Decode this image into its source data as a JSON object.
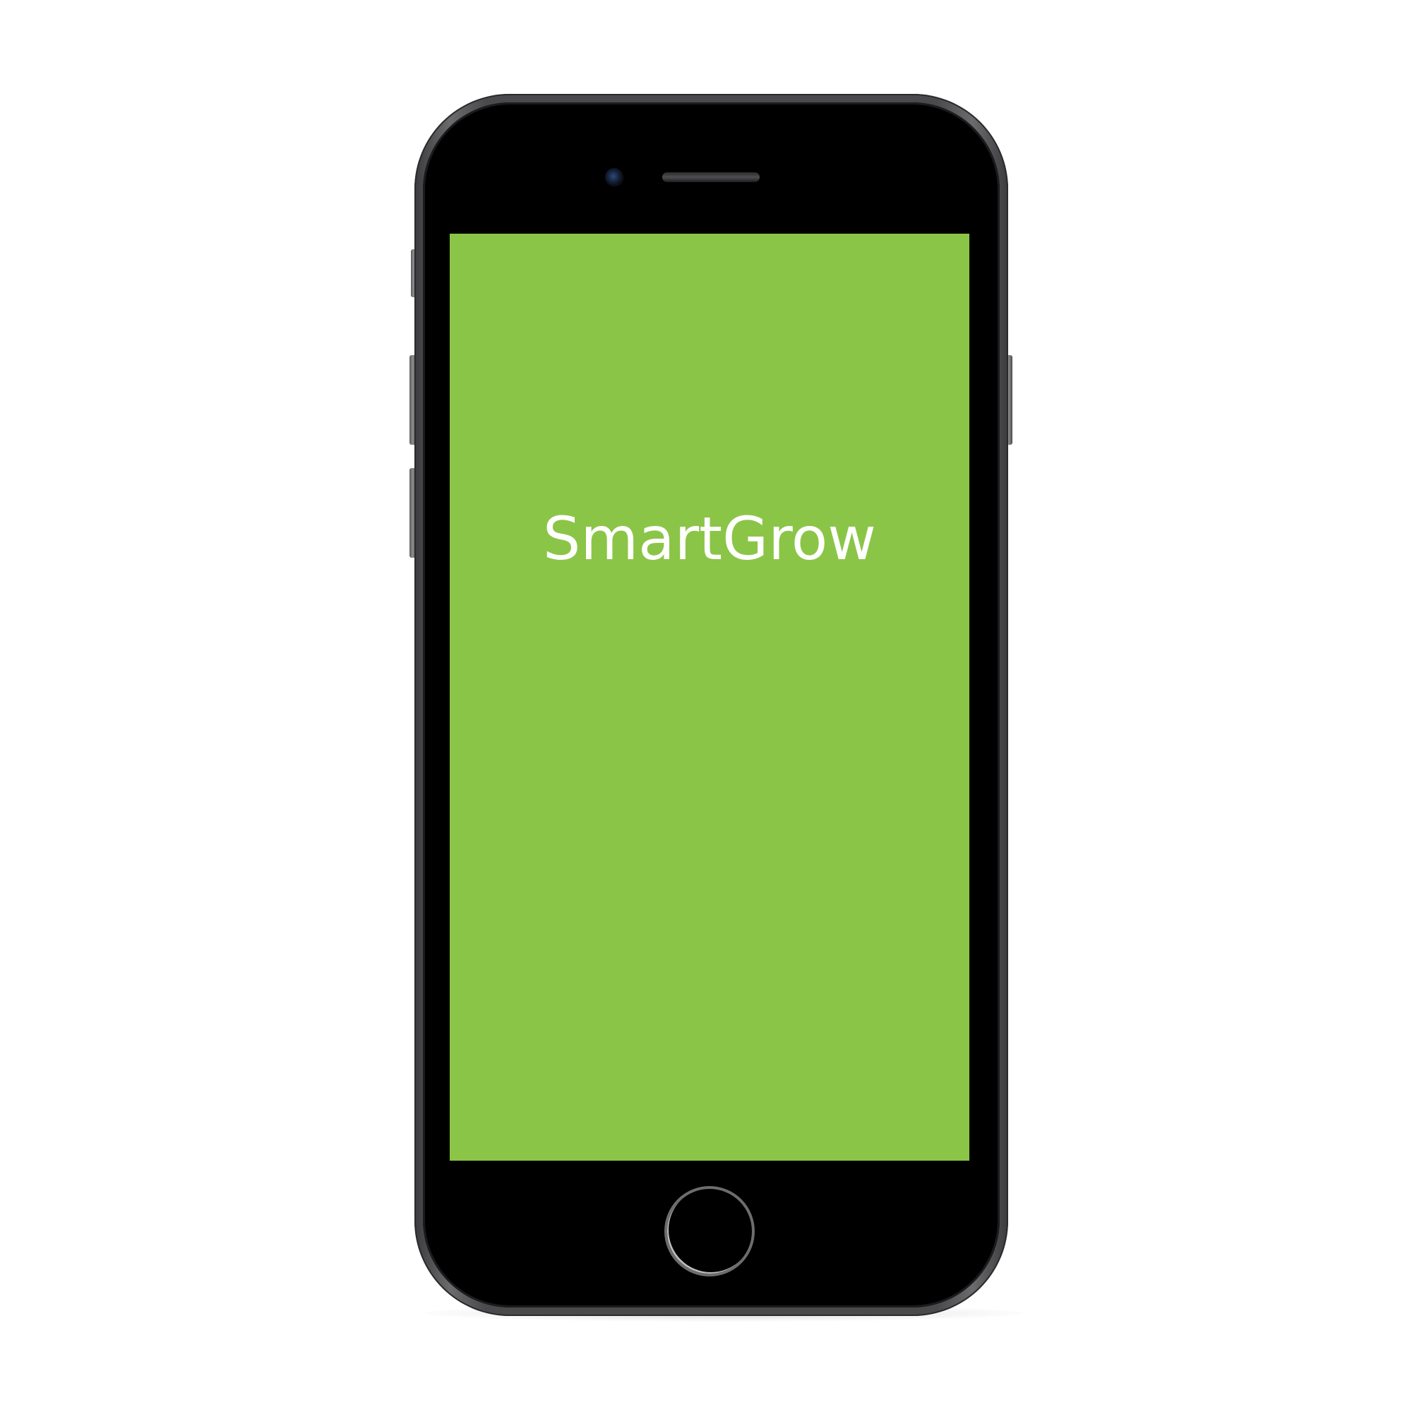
{
  "app": {
    "name": "SmartGrow"
  },
  "screen": {
    "background_color": "#8bc547",
    "text_color": "#ffffff"
  },
  "device": {
    "frame_color": "#4a4a4c",
    "icons": {
      "camera": "front-camera-icon",
      "speaker": "earpiece-speaker-icon",
      "home": "home-button-icon"
    }
  }
}
